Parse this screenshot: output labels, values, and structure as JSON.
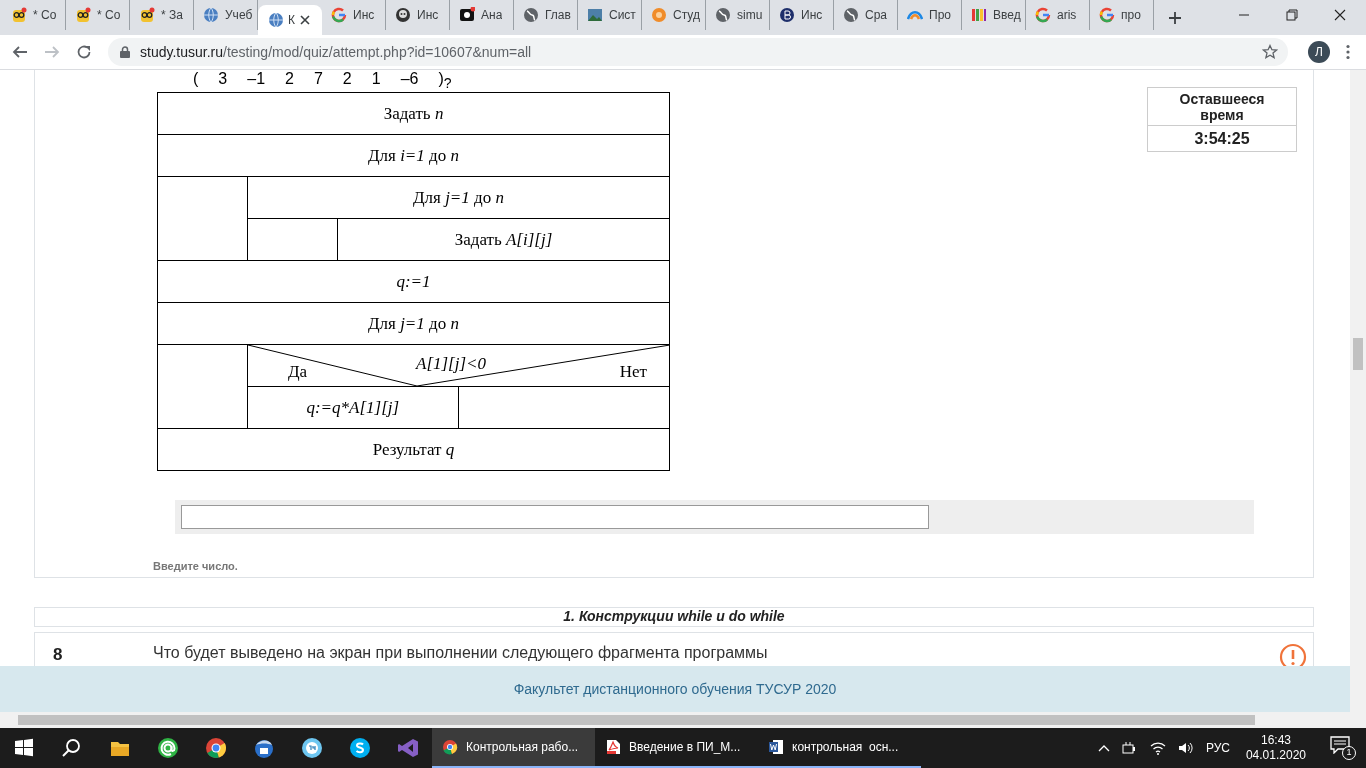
{
  "browser": {
    "tabs": [
      {
        "label": "* Со",
        "selected": false
      },
      {
        "label": "* Со",
        "selected": false
      },
      {
        "label": "* За",
        "selected": false
      },
      {
        "label": "Учеб",
        "selected": false
      },
      {
        "label": "К",
        "selected": true
      },
      {
        "label": "Инс",
        "selected": false
      },
      {
        "label": "Инс",
        "selected": false
      },
      {
        "label": "Ана",
        "selected": false
      },
      {
        "label": "Глав",
        "selected": false
      },
      {
        "label": "Сист",
        "selected": false
      },
      {
        "label": "Студ",
        "selected": false
      },
      {
        "label": "simu",
        "selected": false
      },
      {
        "label": "Инс",
        "selected": false
      },
      {
        "label": "Сра",
        "selected": false
      },
      {
        "label": "Про",
        "selected": false
      },
      {
        "label": "Введ",
        "selected": false
      },
      {
        "label": "aris",
        "selected": false
      },
      {
        "label": "про",
        "selected": false
      }
    ],
    "url_host": "study.tusur.ru",
    "url_path": "/testing/mod/quiz/attempt.php?id=10607&num=all",
    "profile_initial": "Л"
  },
  "question": {
    "matrix_row": [
      "(",
      "3",
      "–1",
      "2",
      "7",
      "2",
      "1",
      "–6",
      ")"
    ],
    "matrix_suffix": "?",
    "diagram": [
      {
        "kind": "action",
        "text": "Задать *n*"
      },
      {
        "kind": "loop",
        "text": "Для *i=1* до *n*",
        "body": [
          {
            "kind": "loop",
            "text": "Для *j=1* до *n*",
            "body": [
              {
                "kind": "action",
                "text": "Задать *A[i][j]*"
              }
            ]
          }
        ]
      },
      {
        "kind": "action",
        "text": "q:=1",
        "italic": true
      },
      {
        "kind": "loop",
        "text": "Для *j=1* до *n*",
        "body": [
          {
            "kind": "if",
            "condition": "A[1][j]<0",
            "yes_label": "Да",
            "no_label": "Нет",
            "yes": [
              {
                "kind": "action",
                "text": "q:=q*A[1][j]",
                "italic": true
              }
            ]
          }
        ]
      },
      {
        "kind": "action",
        "text": "Результат *q*"
      }
    ],
    "hint": "Введите число."
  },
  "timer": {
    "title": "Оставшееся время",
    "value": "3:54:25"
  },
  "section_heading": "1. Конструкции while и do while",
  "next_question": {
    "number": "8",
    "text": "Что будет выведено на экран при выполнении следующего фрагмента программы"
  },
  "footer": "Факультет дистанционного обучения ТУСУР 2020",
  "taskbar": {
    "tasks": [
      {
        "label": "Контрольная рабо...",
        "selected": true
      },
      {
        "label": "Введение в ПИ_М...",
        "selected": false
      },
      {
        "label": "контрольная  осн...",
        "selected": false
      }
    ],
    "language": "РУС",
    "time": "16:43",
    "date": "04.01.2020",
    "notifications": "1"
  }
}
